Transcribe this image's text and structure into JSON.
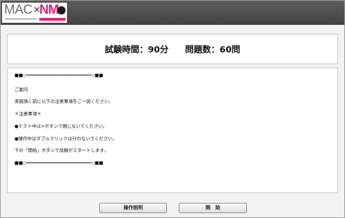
{
  "logo": {
    "text_left": "MAC",
    "separator": "×",
    "text_right": "NM"
  },
  "exam": {
    "time_label": "試験時間：90分",
    "questions_label": "問題数：60問"
  },
  "notice": {
    "lines": [
      "■■◇━━━━━━━━━━━━━━━━━━━━━━━━◇■■",
      "ご案内",
      "実施頂く前に以下の注意事項をご一読ください。",
      "＊注意事項＊",
      "●テスト中は×ボタンで閉じないでください。",
      "●操作中はダブルクリックは行わないでください。",
      "下の「開始」ボタンで試験がスタートします。",
      "■■◇━━━━━━━━━━━━━━━━━━━━━━━━◇■■"
    ]
  },
  "buttons": {
    "guide_label": "操作説明",
    "start_label": "開　始"
  },
  "colors": {
    "header": "#4f4f4f",
    "brand_pink": "#e0237b",
    "background": "#f2f2f2"
  }
}
